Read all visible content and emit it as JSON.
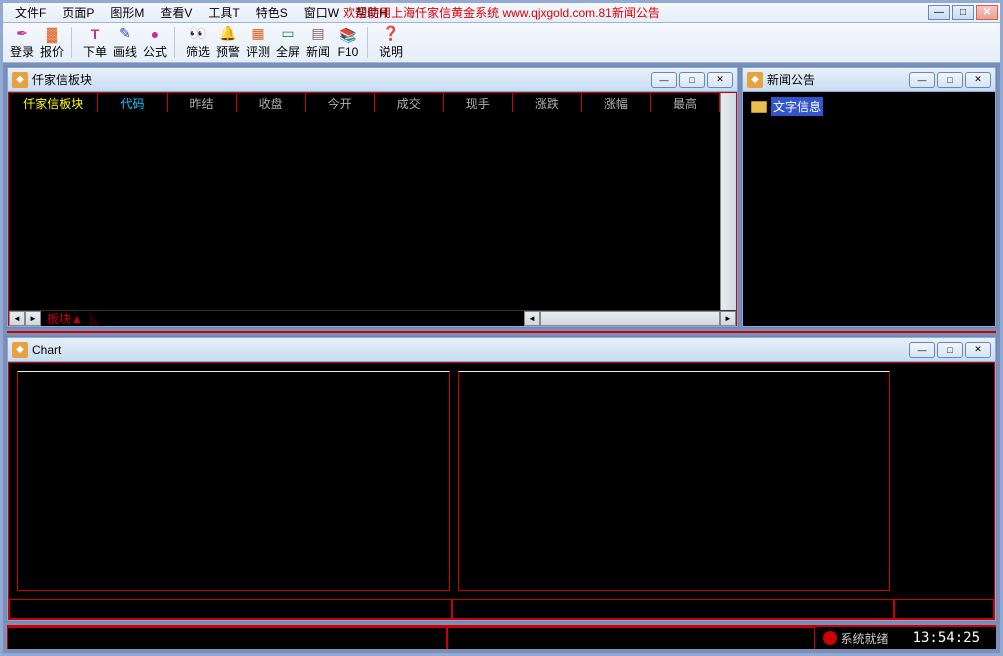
{
  "menubar": {
    "items": [
      "文件F",
      "页面P",
      "图形M",
      "查看V",
      "工具T",
      "特色S",
      "窗口W",
      "帮助H"
    ],
    "welcome": "欢迎使用上海仟家信黄金系统 www.qjxgold.com.81新闻公告"
  },
  "toolbar": {
    "items": [
      {
        "label": "登录",
        "icon": "✒",
        "color": "#c030a0"
      },
      {
        "label": "报价",
        "icon": "▓",
        "color": "#e06020"
      },
      {
        "label": "下单",
        "icon": "T",
        "color": "#c030a0"
      },
      {
        "label": "画线",
        "icon": "✎",
        "color": "#2050c0"
      },
      {
        "label": "公式",
        "icon": "●",
        "color": "#c030a0"
      },
      {
        "label": "筛选",
        "icon": "🔍",
        "color": "#806020"
      },
      {
        "label": "预警",
        "icon": "🔔",
        "color": "#c030a0"
      },
      {
        "label": "评测",
        "icon": "▦",
        "color": "#e06020"
      },
      {
        "label": "全屏",
        "icon": "▭",
        "color": "#208040"
      },
      {
        "label": "新闻",
        "icon": "▤",
        "color": "#806060"
      },
      {
        "label": "F10",
        "icon": "📚",
        "color": "#c06020"
      },
      {
        "label": "说明",
        "icon": "?",
        "color": "#808080"
      }
    ]
  },
  "panel1": {
    "title": "仟家信板块",
    "columns": [
      "仟家信板块",
      "代码",
      "昨结",
      "收盘",
      "今开",
      "成交",
      "现手",
      "涨跌",
      "涨幅",
      "最高"
    ],
    "tab": "板块▲"
  },
  "panel2": {
    "title": "新闻公告",
    "tree_item": "文字信息"
  },
  "chart": {
    "title": "Chart"
  },
  "status": {
    "text": "系统就绪",
    "time": "13:54:25"
  }
}
